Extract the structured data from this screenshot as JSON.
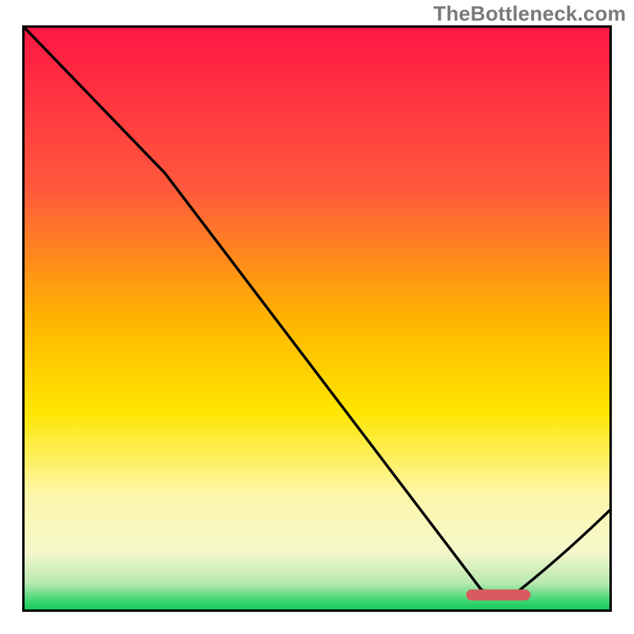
{
  "watermark": "TheBottleneck.com",
  "colors": {
    "frame": "#000000",
    "line": "#000000",
    "marker_fill": "#d95a5f",
    "marker_stroke": "#a33f44",
    "grad_stops": [
      {
        "offset": 0.0,
        "color": "#ff1744"
      },
      {
        "offset": 0.28,
        "color": "#ff5a3c"
      },
      {
        "offset": 0.5,
        "color": "#ffb400"
      },
      {
        "offset": 0.66,
        "color": "#ffe600"
      },
      {
        "offset": 0.8,
        "color": "#fdf6a8"
      },
      {
        "offset": 0.9,
        "color": "#f5f8cc"
      },
      {
        "offset": 0.955,
        "color": "#b8e8b0"
      },
      {
        "offset": 0.985,
        "color": "#3fd673"
      },
      {
        "offset": 1.0,
        "color": "#14c95a"
      }
    ]
  },
  "chart_data": {
    "type": "line",
    "title": "",
    "xlabel": "",
    "ylabel": "",
    "xlim": [
      0,
      1
    ],
    "ylim": [
      0,
      1
    ],
    "note": "Axes are unlabeled in the source image; x/y expressed as fractions of the framed plot area (0,0 = bottom-left, 1,1 = top-right). Values are read off visually.",
    "series": [
      {
        "name": "curve",
        "points": [
          {
            "x": 0.0,
            "y": 1.0
          },
          {
            "x": 0.24,
            "y": 0.75
          },
          {
            "x": 0.78,
            "y": 0.035
          },
          {
            "x": 0.83,
            "y": 0.02
          },
          {
            "x": 1.0,
            "y": 0.17
          }
        ]
      }
    ],
    "marker": {
      "shape": "rounded-bar",
      "x_start": 0.755,
      "x_end": 0.865,
      "y": 0.025
    },
    "gradient_direction": "top-to-bottom"
  }
}
